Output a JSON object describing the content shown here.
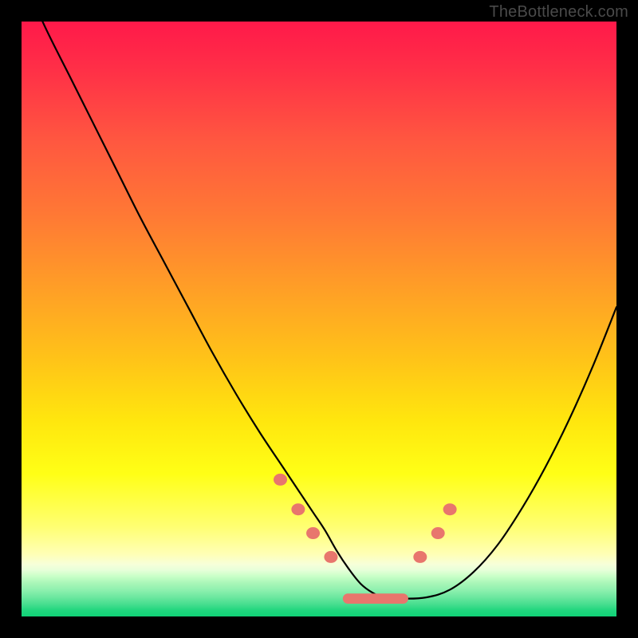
{
  "watermark": "TheBottleneck.com",
  "colors": {
    "frame_bg": "#000000",
    "curve_stroke": "#000000",
    "marker_fill": "#e8766d",
    "marker_stroke": "#b85a55",
    "gradient_top": "#ff194a",
    "gradient_bottom": "#10d277"
  },
  "chart_data": {
    "type": "line",
    "title": "",
    "xlabel": "",
    "ylabel": "",
    "xlim": [
      0,
      100
    ],
    "ylim": [
      0,
      100
    ],
    "grid": false,
    "legend": false,
    "x": [
      0,
      4,
      8,
      12,
      16,
      20,
      24,
      28,
      32,
      36,
      40,
      44,
      47,
      49,
      51,
      53,
      55,
      57,
      59,
      61,
      64,
      68,
      72,
      76,
      80,
      84,
      88,
      92,
      96,
      100
    ],
    "values": [
      108,
      99,
      91,
      83,
      75,
      67,
      59.5,
      52,
      44.5,
      37.5,
      31,
      25,
      20.5,
      17.5,
      14.5,
      11,
      8,
      5.5,
      4,
      3.2,
      3,
      3.2,
      4.5,
      7.5,
      12,
      18,
      25,
      33,
      42,
      52
    ],
    "markers": [
      {
        "x": 43.5,
        "y": 23
      },
      {
        "x": 46.5,
        "y": 18
      },
      {
        "x": 49.0,
        "y": 14
      },
      {
        "x": 52.0,
        "y": 10
      },
      {
        "x": 67.0,
        "y": 10
      },
      {
        "x": 70.0,
        "y": 14
      },
      {
        "x": 72.0,
        "y": 18
      }
    ],
    "bar_segment": {
      "x_start": 54,
      "x_end": 65,
      "y": 3,
      "thickness_pct": 1.7
    }
  }
}
